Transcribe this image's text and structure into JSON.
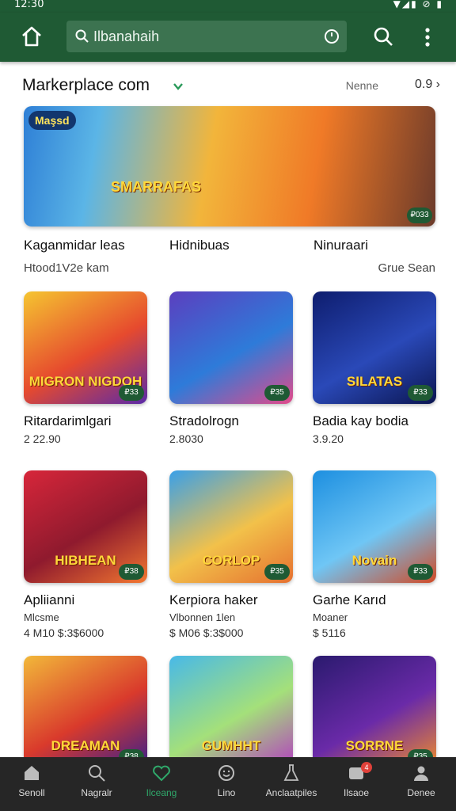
{
  "status_bar": {
    "time": "12:30",
    "icons_text": "▼◢▮ ⊘ ▮"
  },
  "appbar": {
    "search_value": "Ilbanahaih"
  },
  "section": {
    "title": "Markerplace com",
    "sort_label": "Nenne",
    "sort_value": "0.9 ›"
  },
  "featured": {
    "logo_text": "Maşsd",
    "art_title": "SMARRAFAS",
    "badge": "₽033",
    "labels": [
      "Kaganmidar leas",
      "Hidnibuas",
      "Ninuraari"
    ],
    "sub_left": "Htood1V2e kam",
    "sub_right": "Grue Sean"
  },
  "cards": [
    {
      "title": "Ritardarimlgari",
      "price": "2 22.90",
      "art": "MIGRON NIGDOH",
      "badge": "₽33",
      "colors": [
        "#f5c531",
        "#e64a2e",
        "#5a2aa8"
      ]
    },
    {
      "title": "Stradolrogn",
      "price": "2.8030",
      "art": "",
      "badge": "₽35",
      "colors": [
        "#5b3fbf",
        "#2e7bd9",
        "#e24a8a"
      ]
    },
    {
      "title": "Badia kay bodia",
      "price": "3.9.20",
      "art": "SILATAS",
      "badge": "₽33",
      "colors": [
        "#0e1d6e",
        "#2a49b8",
        "#0b1550"
      ]
    },
    {
      "title": "Apliianni",
      "sub": "Mlcsme",
      "price": "4 M10 $:3$6000",
      "art": "HIBHEAN",
      "badge": "₽38",
      "colors": [
        "#d7263a",
        "#8f1a2e",
        "#f27730"
      ]
    },
    {
      "title": "Kerpiora haker",
      "sub": "Vlbonnen 1len",
      "price": "$ M06 $:3$000",
      "art": "CORLOP",
      "badge": "₽35",
      "colors": [
        "#3aa0e8",
        "#f2c14a",
        "#e57030"
      ]
    },
    {
      "title": "Garhe Karıd",
      "sub": "Moaner",
      "price": "$ 5116",
      "art": "Novain",
      "badge": "₽33",
      "colors": [
        "#1d8fe0",
        "#6fc6f5",
        "#d14a26"
      ]
    },
    {
      "title": "",
      "price": "",
      "art": "DREAMAN",
      "badge": "₽38",
      "colors": [
        "#f2b83a",
        "#d93a2c",
        "#3a1f8c"
      ]
    },
    {
      "title": "",
      "price": "",
      "art": "GUMHHT",
      "badge": "",
      "colors": [
        "#48b9e8",
        "#a4e07a",
        "#b33ec0"
      ]
    },
    {
      "title": "",
      "price": "",
      "art": "SORRNE",
      "badge": "₽35",
      "colors": [
        "#2a1a6e",
        "#6a2aa8",
        "#f08c2a"
      ]
    }
  ],
  "nav": [
    {
      "label": "Senoll",
      "icon": "home-icon"
    },
    {
      "label": "Nagralr",
      "icon": "search-icon"
    },
    {
      "label": "Ilceang",
      "icon": "heart-icon"
    },
    {
      "label": "Lino",
      "icon": "smiley-icon"
    },
    {
      "label": "Anclaatpiles",
      "icon": "flask-icon"
    },
    {
      "label": "Ilsaoe",
      "icon": "inbox-icon",
      "badge": "4"
    },
    {
      "label": "Denee",
      "icon": "person-icon"
    }
  ],
  "colors": {
    "brand": "#1f5a34",
    "accent": "#2fa86a",
    "navbar": "#262626"
  }
}
